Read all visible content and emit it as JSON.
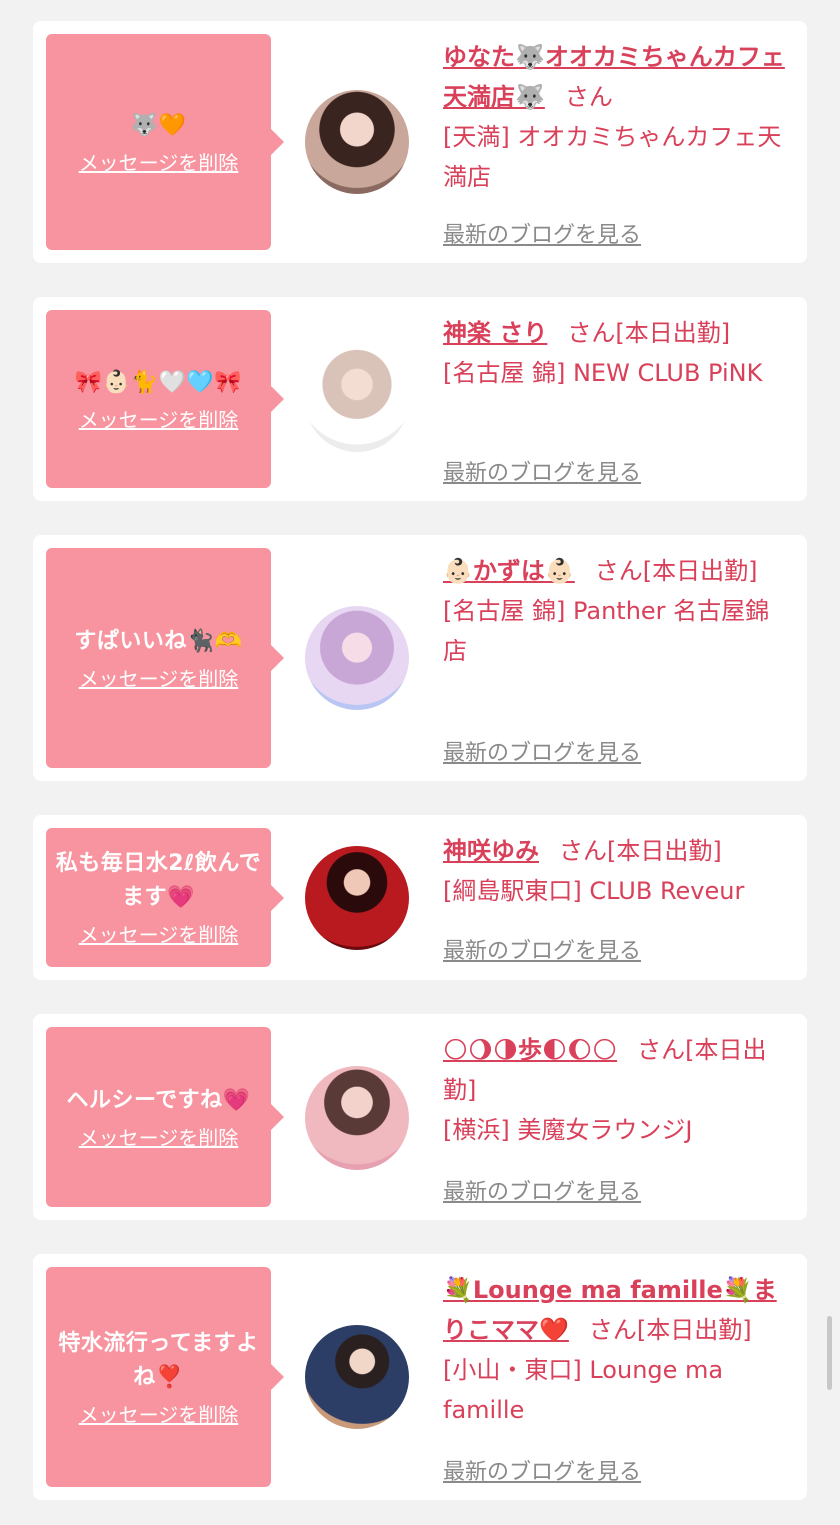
{
  "delete_label": "メッセージを削除",
  "blog_label": "最新のブログを見る",
  "san_label": "さん",
  "colors": {
    "accent": "#d9405a",
    "bubble": "#f7949f",
    "link_gray": "#8a8a8a",
    "page_bg": "#f2f2f2"
  },
  "items": [
    {
      "message": "🐺🧡",
      "name": "ゆなた🐺オオカミちゃんカフェ天満店🐺",
      "san_suffix": "さん",
      "shop": "[天満] オオカミちゃんカフェ天満店",
      "avatar_icon": "woman-portrait-avatar"
    },
    {
      "message": "🎀👶🏻🐈🤍🩵🎀",
      "name": "神楽 さり",
      "san_suffix": "さん[本日出勤]",
      "shop": "[名古屋 錦] NEW CLUB PiNK",
      "avatar_icon": "woman-portrait-avatar"
    },
    {
      "message": "すぱいいね🐈‍⬛🫶",
      "name": "👶🏻かずは👶🏻",
      "san_suffix": "さん[本日出勤]",
      "shop": "[名古屋 錦] Panther 名古屋錦店",
      "avatar_icon": "woman-portrait-avatar"
    },
    {
      "message": "私も毎日水2ℓ飲んでます💗",
      "name": "神咲ゆみ",
      "san_suffix": "さん[本日出勤]",
      "shop": "[綱島駅東口] CLUB Reveur",
      "avatar_icon": "woman-portrait-avatar"
    },
    {
      "message": "ヘルシーですね💗",
      "name": "🌕🌖🌗歩🌓🌔🌕",
      "san_suffix": "さん[本日出勤]",
      "shop": "[横浜] 美魔女ラウンジJ",
      "avatar_icon": "woman-portrait-avatar"
    },
    {
      "message": "特水流行ってますよね❣️",
      "name": "💐Lounge ma famille💐まりこママ❤️",
      "san_suffix": "さん[本日出勤]",
      "shop": "[小山・東口] Lounge ma famille",
      "avatar_icon": "woman-portrait-avatar"
    }
  ]
}
